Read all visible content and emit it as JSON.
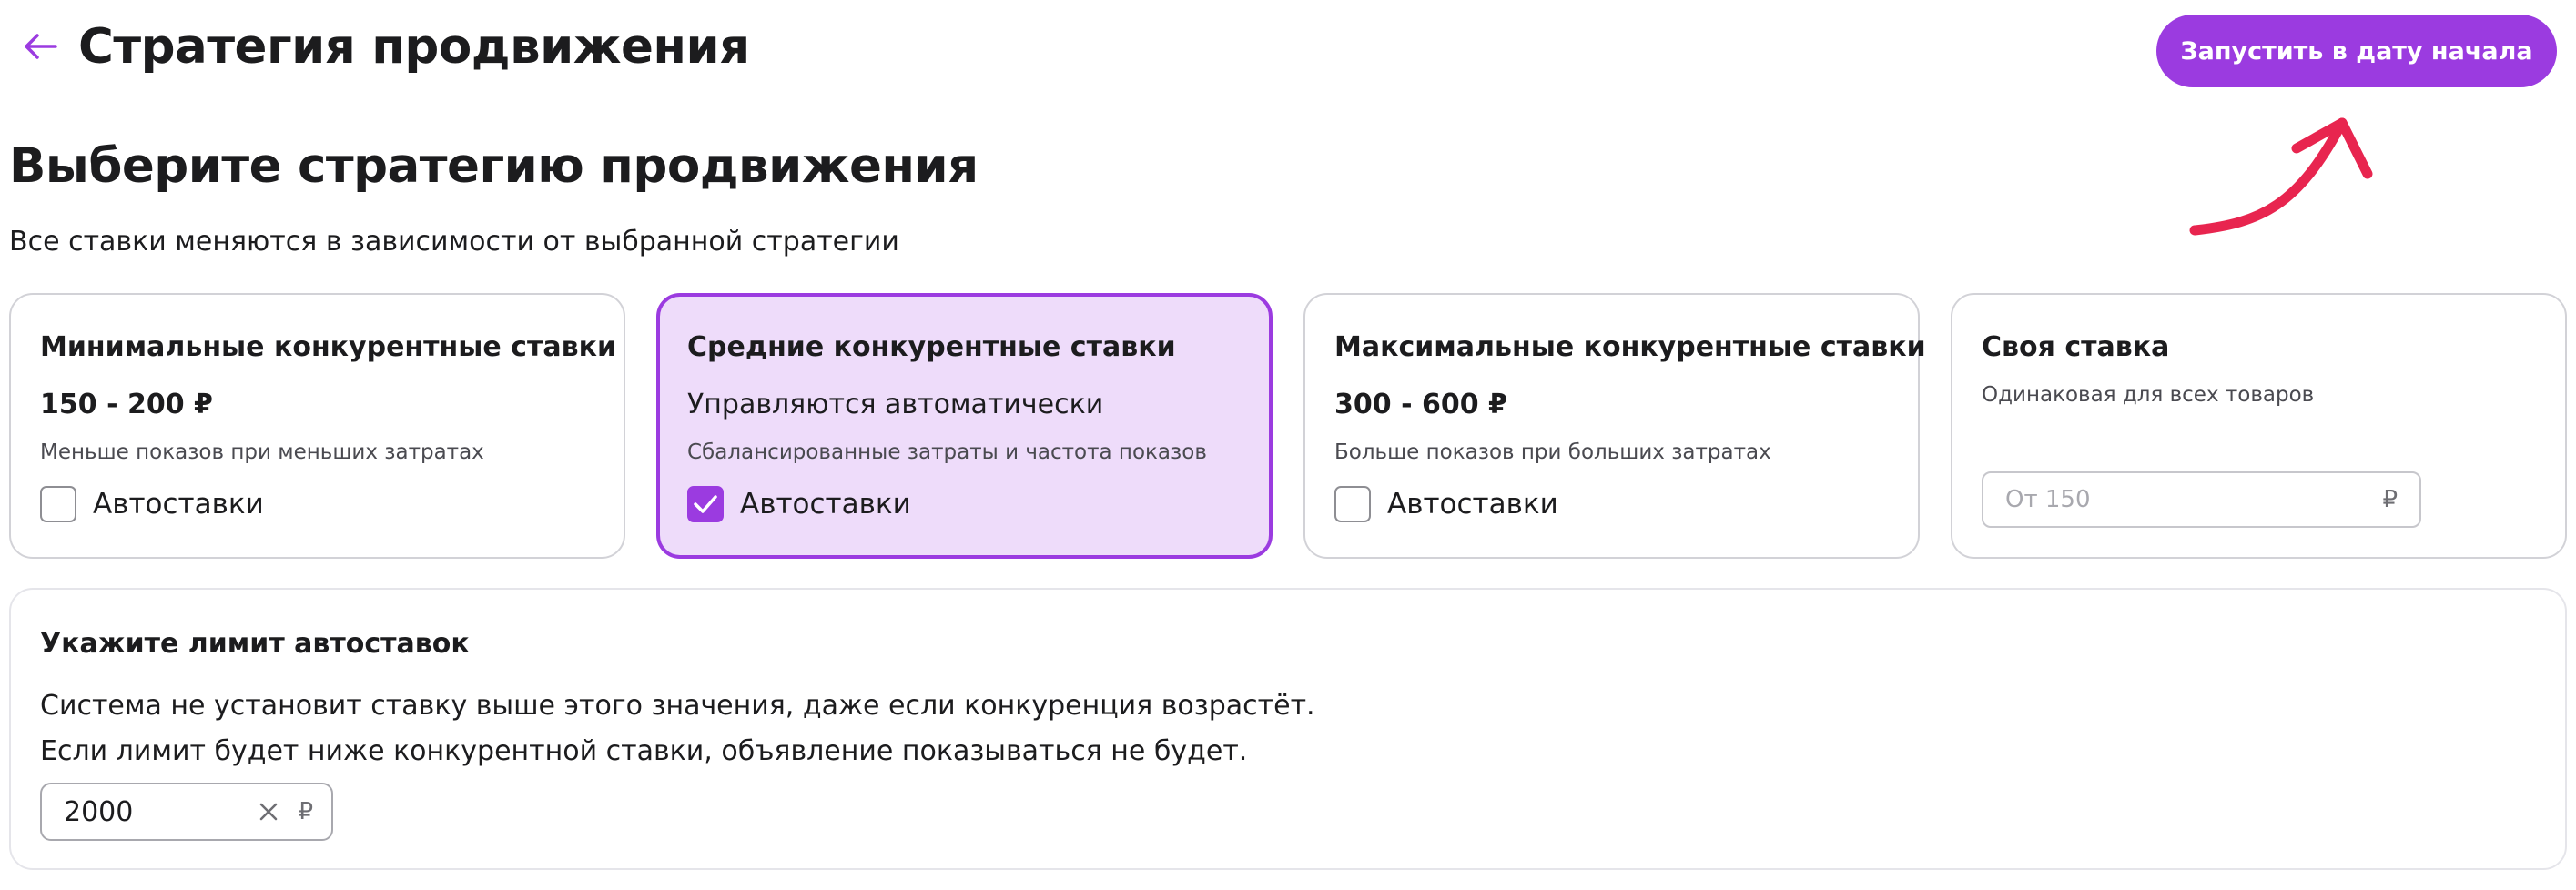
{
  "header": {
    "title": "Стратегия продвижения",
    "launch_button": "Запустить в дату начала"
  },
  "section": {
    "title": "Выберите стратегию продвижения",
    "subtitle": "Все ставки меняются в зависимости от выбранной стратегии"
  },
  "cards": [
    {
      "title": "Минимальные конкурентные ставки",
      "price": "150 - 200 ₽",
      "description": "Меньше показов при меньших затратах",
      "checkbox_label": "Автоставки",
      "checked": false
    },
    {
      "title": "Средние конкурентные ставки",
      "subtitle": "Управляются автоматически",
      "description": "Сбалансированные затраты и частота показов",
      "checkbox_label": "Автоставки",
      "checked": true,
      "selected": true
    },
    {
      "title": "Максимальные конкурентные ставки",
      "price": "300 - 600 ₽",
      "description": "Больше показов при больших затратах",
      "checkbox_label": "Автоставки",
      "checked": false
    },
    {
      "title": "Своя ставка",
      "description": "Одинаковая для всех товаров",
      "input_placeholder": "От 150",
      "currency": "₽"
    }
  ],
  "limit": {
    "title": "Укажите лимит автоставок",
    "line1": "Система не установит ставку выше этого значения, даже если конкуренция возрастёт.",
    "line2": "Если лимит будет ниже конкурентной ставки, объявление показываться не будет.",
    "value": "2000",
    "currency": "₽"
  },
  "colors": {
    "accent": "#9b3be0",
    "selected_background": "#eedcfa",
    "annotation_arrow": "#e8254f"
  },
  "icons": {
    "back": "back-arrow-icon",
    "check": "checkmark-icon",
    "clear": "close-icon",
    "annotation": "curved-arrow-icon"
  }
}
